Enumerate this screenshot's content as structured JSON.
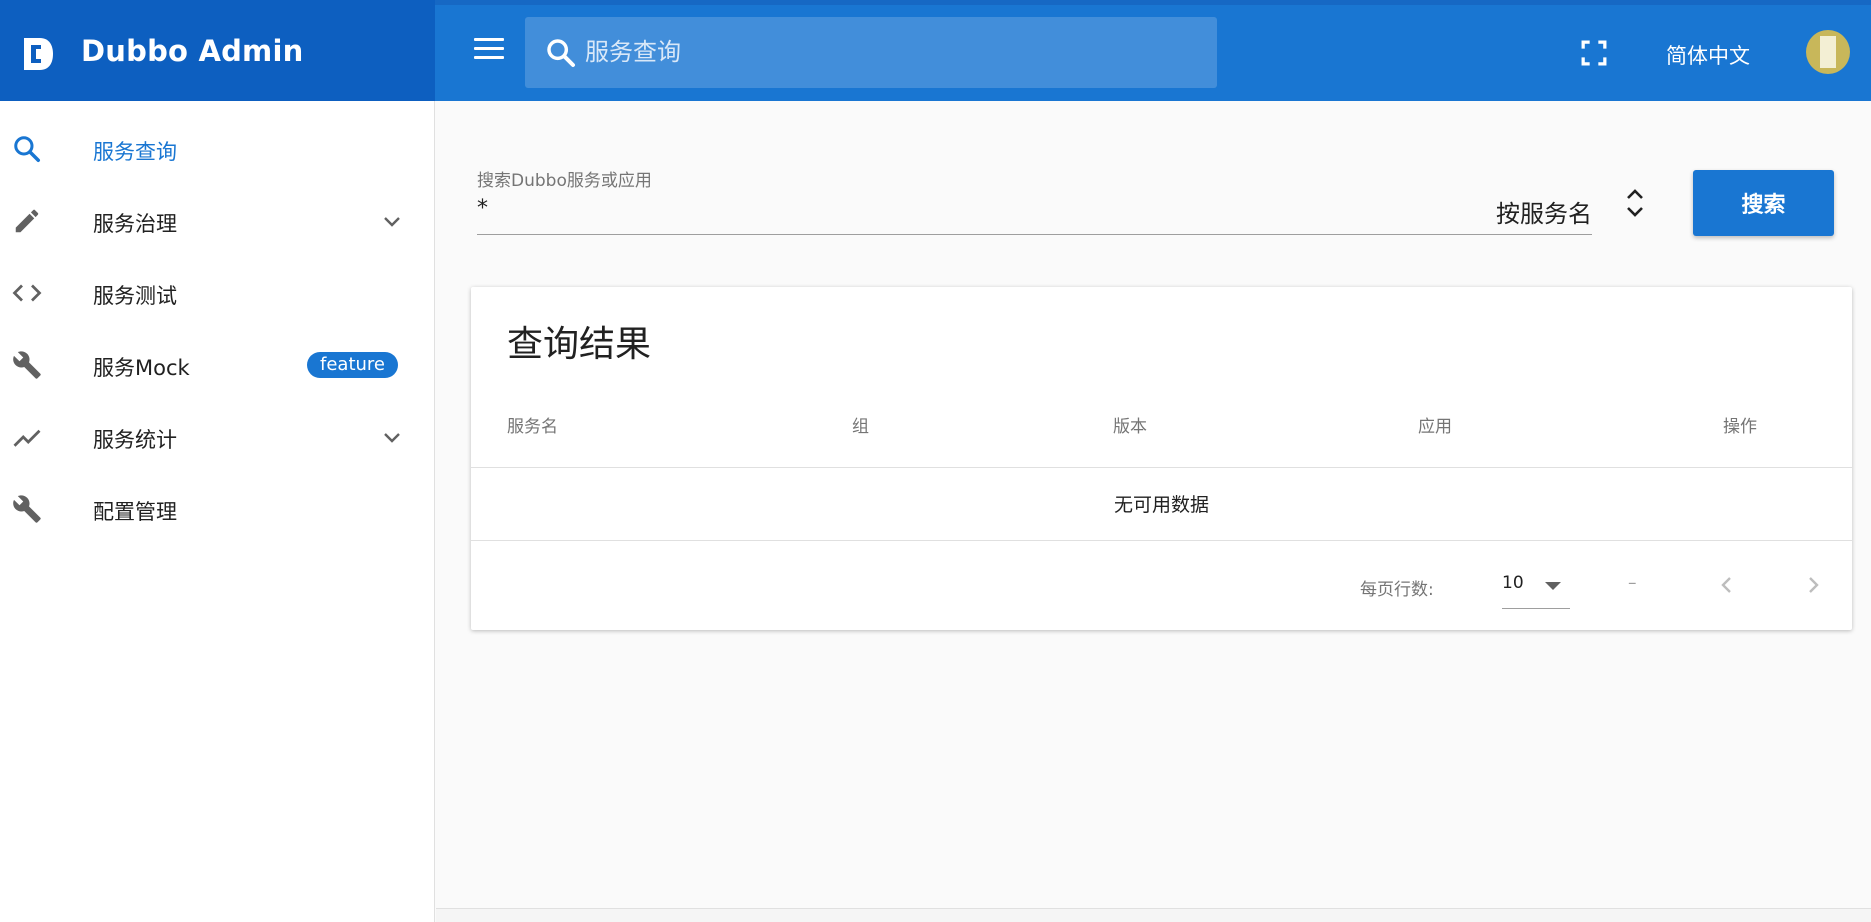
{
  "app": {
    "title": "Dubbo Admin",
    "accent_color": "#1976d2",
    "brand_color": "#0d5fc0"
  },
  "topbar": {
    "menu_icon": "hamburger-menu-icon",
    "search_placeholder": "服务查询",
    "fullscreen_icon": "fullscreen-icon",
    "language": "简体中文"
  },
  "sidebar": {
    "items": [
      {
        "label": "服务查询",
        "icon": "search-icon",
        "active": true
      },
      {
        "label": "服务治理",
        "icon": "pencil-icon",
        "expandable": true
      },
      {
        "label": "服务测试",
        "icon": "code-icon"
      },
      {
        "label": "服务Mock",
        "icon": "wrench-icon",
        "badge": "feature"
      },
      {
        "label": "服务统计",
        "icon": "trending-line-icon",
        "expandable": true
      },
      {
        "label": "配置管理",
        "icon": "wrench-icon"
      }
    ]
  },
  "search": {
    "label": "搜索Dubbo服务或应用",
    "value": "*",
    "mode": "按服务名",
    "button_label": "搜索"
  },
  "results": {
    "title": "查询结果",
    "columns": [
      "服务名",
      "组",
      "版本",
      "应用",
      "操作"
    ],
    "empty_text": "无可用数据",
    "pagination": {
      "rows_per_page_label": "每页行数:",
      "rows_per_page": "10",
      "range": "–"
    }
  }
}
